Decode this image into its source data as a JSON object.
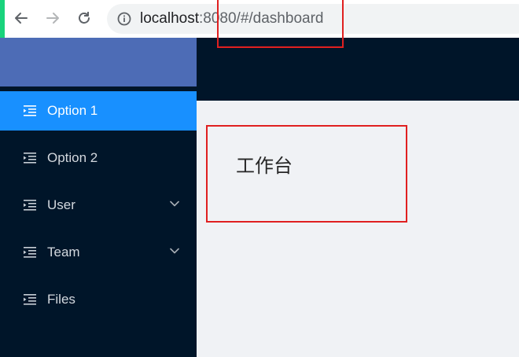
{
  "browser": {
    "url_host": "localhost",
    "url_rest": ":8080/#/dashboard",
    "icons": [
      "back-arrow-icon",
      "forward-arrow-icon",
      "reload-icon",
      "info-icon"
    ]
  },
  "sidebar": {
    "items": [
      {
        "label": "Option 1",
        "active": true,
        "icon": "menu-fold-icon"
      },
      {
        "label": "Option 2",
        "active": false,
        "icon": "menu-fold-icon"
      },
      {
        "label": "User",
        "active": false,
        "icon": "menu-fold-icon",
        "expandable": true
      },
      {
        "label": "Team",
        "active": false,
        "icon": "menu-fold-icon",
        "expandable": true
      },
      {
        "label": "Files",
        "active": false,
        "icon": "menu-fold-icon"
      }
    ]
  },
  "main": {
    "heading": "工作台"
  },
  "colors": {
    "sidebar_bg": "#001529",
    "active_item": "#1890ff",
    "logo_area": "#4d6cb6",
    "content_bg": "#f0f2f5",
    "annotation": "#e02020",
    "accent_strip": "#19d37c"
  }
}
